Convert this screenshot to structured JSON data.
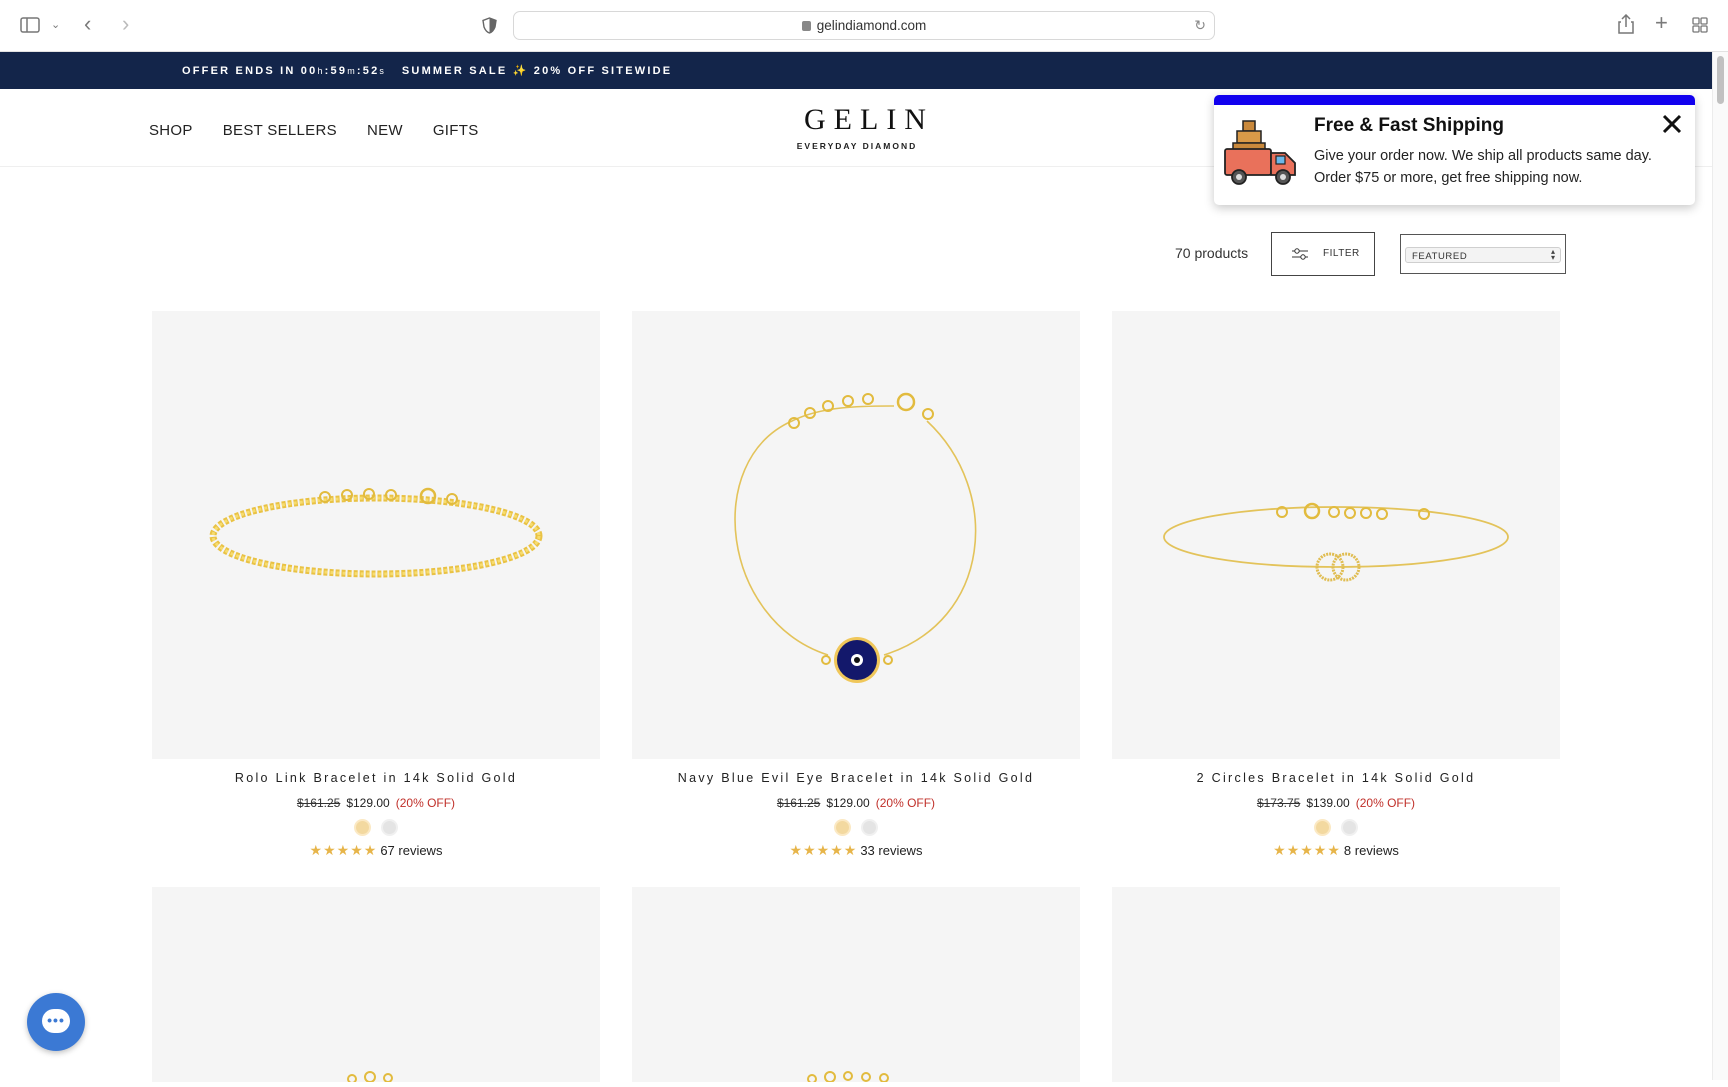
{
  "browser": {
    "url": "gelindiamond.com"
  },
  "promo": {
    "text_a": "OFFER ENDS IN 00",
    "h": "h",
    "sep1": ":",
    "m_val": "59",
    "m": "m",
    "sep2": ":",
    "s_val": "52",
    "s": "s",
    "text_b": "SUMMER SALE ✨ 20% OFF SITEWIDE"
  },
  "nav": {
    "items": [
      "SHOP",
      "BEST SELLERS",
      "NEW",
      "GIFTS"
    ]
  },
  "logo": {
    "name": "GELIN",
    "tagline": "EVERYDAY DIAMOND"
  },
  "toolbar": {
    "count": "70 products",
    "filter_label": "FILTER",
    "sort_value": "FEATURED"
  },
  "popup": {
    "title": "Free & Fast Shipping",
    "body_line1": "Give your order now. We ship all products same day.",
    "body_line2": "Order $75 or more, get free shipping now."
  },
  "products": [
    {
      "title": "Rolo Link Bracelet in 14k Solid Gold",
      "old_price": "$161.25",
      "price": "$129.00",
      "discount": "(20% OFF)",
      "stars": "★★★★★",
      "reviews": "67 reviews",
      "image": "gold-chain-bracelet"
    },
    {
      "title": "Navy Blue Evil Eye Bracelet in 14k Solid Gold",
      "old_price": "$161.25",
      "price": "$129.00",
      "discount": "(20% OFF)",
      "stars": "★★★★★",
      "reviews": "33 reviews",
      "image": "evil-eye-bracelet"
    },
    {
      "title": "2 Circles Bracelet in 14k Solid Gold",
      "old_price": "$173.75",
      "price": "$139.00",
      "discount": "(20% OFF)",
      "stars": "★★★★★",
      "reviews": "8 reviews",
      "image": "two-circles-bracelet"
    }
  ],
  "colors": {
    "promo_bg": "#13254a",
    "popup_accent": "#1100ee",
    "star": "#e7b54a",
    "discount": "#c0302a",
    "chat": "#3b79d4"
  }
}
